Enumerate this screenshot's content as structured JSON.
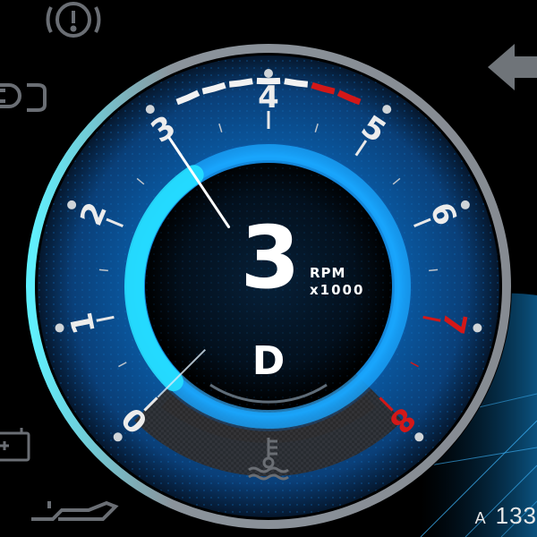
{
  "tachometer": {
    "ticks": [
      {
        "label": "0",
        "value": 0,
        "redline": false
      },
      {
        "label": "1",
        "value": 1,
        "redline": false
      },
      {
        "label": "2",
        "value": 2,
        "redline": false
      },
      {
        "label": "3",
        "value": 3,
        "redline": false
      },
      {
        "label": "4",
        "value": 4,
        "redline": false
      },
      {
        "label": "5",
        "value": 5,
        "redline": false
      },
      {
        "label": "6",
        "value": 6,
        "redline": false
      },
      {
        "label": "7",
        "value": 7,
        "redline": true
      },
      {
        "label": "8",
        "value": 8,
        "redline": true
      }
    ],
    "needle_value": 3,
    "rpm_readout": "3",
    "unit_line1": "RPM",
    "unit_line2": "x1000",
    "gear": "D",
    "colors": {
      "accent": "#19d4ff",
      "redline": "#d31818",
      "bezel": "#8a8f96",
      "dial": "#0a5fa8"
    }
  },
  "temperature_gauge": {
    "icon": "coolant-temperature-icon",
    "segments": [
      "normal",
      "normal",
      "normal",
      "normal",
      "normal",
      "high",
      "high"
    ],
    "colors": {
      "normal": "#f2f2f2",
      "high": "#d31818"
    }
  },
  "warning_icons": [
    "brake-warning-icon",
    "parking-light-icon",
    "battery-icon",
    "oil-pressure-icon",
    "turn-signal-left-icon"
  ],
  "odometer": {
    "prefix": "A",
    "value": "133"
  }
}
